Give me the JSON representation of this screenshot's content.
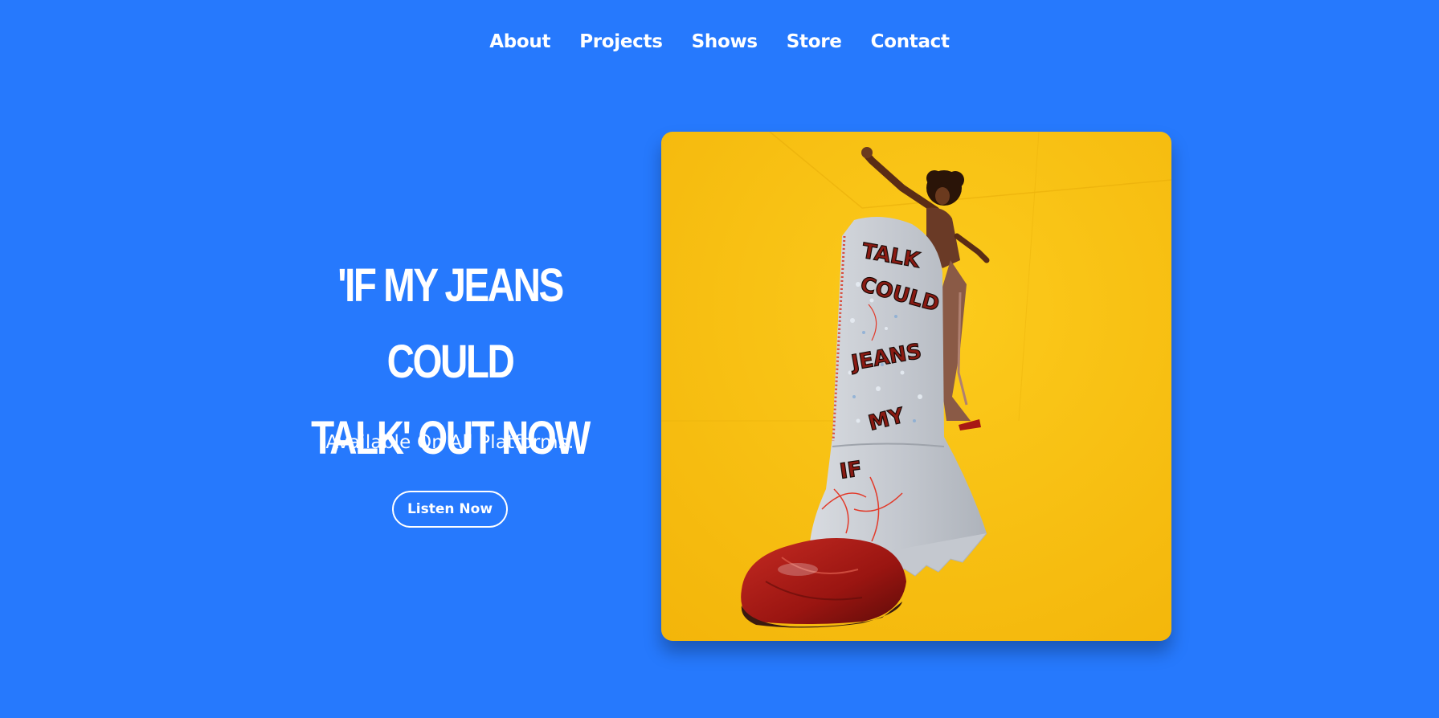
{
  "colors": {
    "page_background": "#2679fd",
    "text": "#ffffff",
    "artwork_background": "#fac210",
    "boot": "#a81814",
    "denim": "#c9ccd2"
  },
  "nav": {
    "items": [
      {
        "label": "About"
      },
      {
        "label": "Projects"
      },
      {
        "label": "Shows"
      },
      {
        "label": "Store"
      },
      {
        "label": "Contact"
      }
    ]
  },
  "hero": {
    "title_line1": "'IF MY JEANS COULD",
    "title_line2": "TALK' OUT NOW",
    "subtitle": "Available On All Platforms.",
    "cta_label": "Listen Now"
  },
  "artwork": {
    "description_icon": "album-cover-image",
    "stitched_words": [
      "TALK",
      "COULD",
      "JEANS",
      "MY",
      "IF"
    ]
  }
}
